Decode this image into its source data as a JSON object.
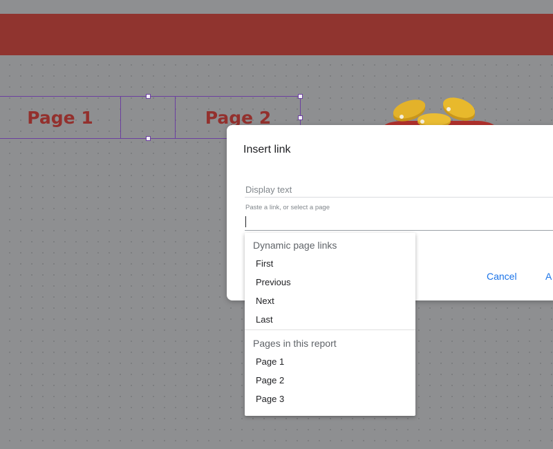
{
  "nav_buttons": [
    {
      "label": "Page 1"
    },
    {
      "label": "Page 2"
    }
  ],
  "dialog": {
    "title": "Insert link",
    "display_text_placeholder": "Display text",
    "link_label": "Paste a link, or select a page",
    "cancel_label": "Cancel",
    "apply_label": "A"
  },
  "dropdown": {
    "dynamic_header": "Dynamic page links",
    "dynamic_items": [
      "First",
      "Previous",
      "Next",
      "Last"
    ],
    "report_header": "Pages in this report",
    "report_items": [
      "Page 1",
      "Page 2",
      "Page 3"
    ]
  },
  "colors": {
    "banner": "#90342f",
    "nav_text": "#93302d",
    "selection": "#6b3fa0",
    "link_blue": "#1a73e8"
  }
}
